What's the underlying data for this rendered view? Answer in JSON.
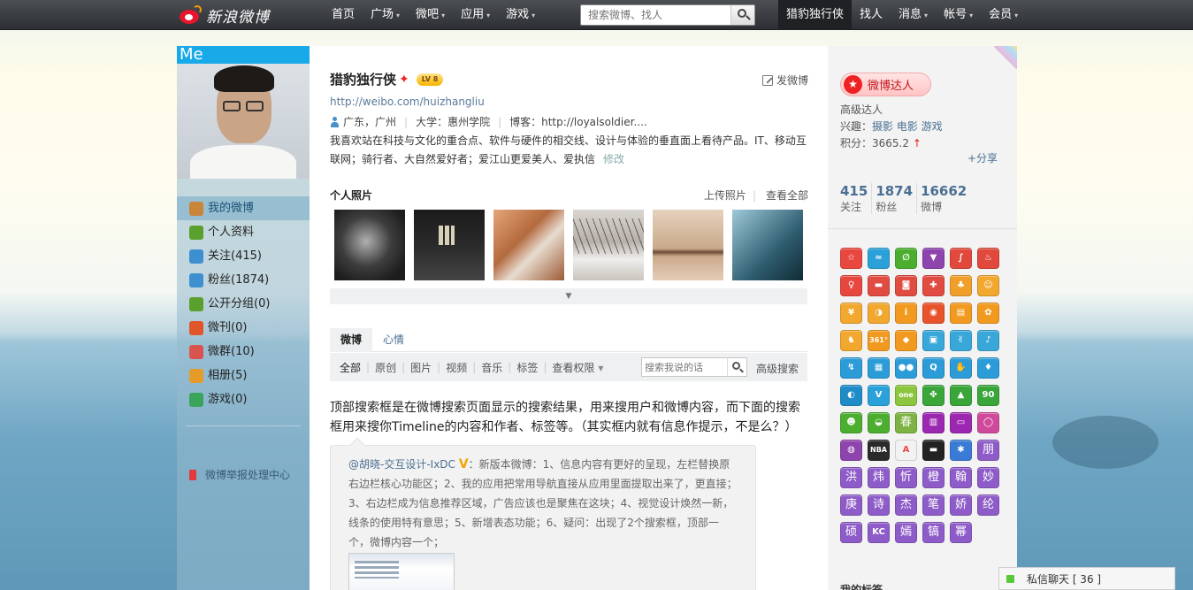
{
  "topbar": {
    "logo_text": "新浪微博",
    "nav": [
      {
        "label": "首页",
        "caret": false
      },
      {
        "label": "广场",
        "caret": true
      },
      {
        "label": "微吧",
        "caret": true
      },
      {
        "label": "应用",
        "caret": true
      },
      {
        "label": "游戏",
        "caret": true
      }
    ],
    "search_placeholder": "搜索微博、找人",
    "right_nav": [
      {
        "label": "猎豹独行侠",
        "caret": false
      },
      {
        "label": "找人",
        "caret": false
      },
      {
        "label": "消息",
        "caret": true
      },
      {
        "label": "帐号",
        "caret": true
      },
      {
        "label": "会员",
        "caret": true
      }
    ],
    "caret_glyph": "▾"
  },
  "left": {
    "avatar_tag": "Me",
    "menu": [
      {
        "label": "我的微博",
        "icon": "home-icon",
        "color": "#c9863a"
      },
      {
        "label": "个人资料",
        "icon": "profile-icon",
        "color": "#5aa02c"
      },
      {
        "label": "关注(415)",
        "icon": "follow-icon",
        "color": "#3d8fd0"
      },
      {
        "label": "粉丝(1874)",
        "icon": "fans-icon",
        "color": "#3d8fd0"
      },
      {
        "label": "公开分组(0)",
        "icon": "group-icon",
        "color": "#5aa02c"
      },
      {
        "label": "微刊(0)",
        "icon": "magazine-icon",
        "color": "#e0552a"
      },
      {
        "label": "微群(10)",
        "icon": "weiqun-icon",
        "color": "#d9534f"
      },
      {
        "label": "相册(5)",
        "icon": "album-icon",
        "color": "#e59b2a"
      },
      {
        "label": "游戏(0)",
        "icon": "game-icon",
        "color": "#3aa55a"
      }
    ],
    "report": "微博举报处理中心"
  },
  "profile": {
    "name": "猎豹独行侠",
    "verified_glyph": "✦",
    "level": "LV 8",
    "post_link": "发微博",
    "url": "http://weibo.com/huizhangliu",
    "location": "广东，广州",
    "school": "大学：惠州学院",
    "blog": "博客：http://loyalsoldier....",
    "bio": "我喜欢站在科技与文化的重合点、软件与硬件的相交线、设计与体验的垂直面上看待产品。IT、移动互联网；骑行者、大自然爱好者；爱江山更爱美人、爱执信",
    "edit": "修改"
  },
  "photos": {
    "title": "个人照片",
    "upload": "上传照片",
    "view_all": "查看全部",
    "more_glyph": "▼"
  },
  "feed": {
    "tabs": [
      "微博",
      "心情"
    ],
    "filters": [
      "全部",
      "原创",
      "图片",
      "视频",
      "音乐",
      "标签",
      "查看权限"
    ],
    "filter_caret": "▾",
    "search_placeholder": "搜索我说的话",
    "advanced": "高级搜索",
    "post_text": "顶部搜索框是在微博搜索页面显示的搜索结果，用来搜用户和微博内容，而下面的搜索框用来搜你Timeline的内容和作者、标签等。（其实框内就有信息作提示，不是么？）",
    "quote_author": "@胡晓-交互设计-IxDC",
    "quote_badge": "V",
    "quote_text": "：新版本微博：1、信息内容有更好的呈现，左栏替换原右边栏核心功能区；2、我的应用把常用导航直接从应用里面提取出来了，更直接；3、右边栏成为信息推荐区域，广告应该也是聚焦在这块；4、视觉设计焕然一新，线条的使用特有意思；5、新增表态功能；6、疑问：出现了2个搜索框，顶部一个，微博内容一个；"
  },
  "right": {
    "badge": "微博达人",
    "level": "高级达人",
    "interests_label": "兴趣：",
    "interests": "摄影 电影 游戏",
    "score_label": "积分：",
    "score": "3665.2",
    "score_up": "↑",
    "share": "+分享",
    "stats": [
      {
        "num": "415",
        "label": "关注"
      },
      {
        "num": "1874",
        "label": "粉丝"
      },
      {
        "num": "16662",
        "label": "微博"
      }
    ],
    "apps": [
      {
        "g": "☆",
        "c": "#e8473f",
        "cn": false,
        "n": "app-star-icon"
      },
      {
        "g": "≈",
        "c": "#2aa1d8",
        "cn": false,
        "n": "app-wave-icon"
      },
      {
        "g": "∅",
        "c": "#4cae2f",
        "cn": false,
        "n": "app-leaf-icon"
      },
      {
        "g": "▼",
        "c": "#8e44ad",
        "cn": false,
        "n": "app-download-icon"
      },
      {
        "g": "∫",
        "c": "#e0493c",
        "cn": false,
        "n": "app-scribble-icon"
      },
      {
        "g": "♨",
        "c": "#e0493c",
        "cn": false,
        "n": "app-fire-icon"
      },
      {
        "g": "♀",
        "c": "#e8473f",
        "cn": false,
        "n": "app-mic-icon"
      },
      {
        "g": "▬",
        "c": "#e14c42",
        "cn": false,
        "n": "app-ship-icon"
      },
      {
        "g": "◙",
        "c": "#e14c42",
        "cn": false,
        "n": "app-camera-icon"
      },
      {
        "g": "✚",
        "c": "#e14c42",
        "cn": false,
        "n": "app-cross-icon"
      },
      {
        "g": "♣",
        "c": "#f0a02a",
        "cn": false,
        "n": "app-bunny-icon"
      },
      {
        "g": "☺",
        "c": "#f2a72e",
        "cn": false,
        "n": "app-face-icon"
      },
      {
        "g": "¥",
        "c": "#f2a72e",
        "cn": false,
        "n": "app-yen-icon"
      },
      {
        "g": "◑",
        "c": "#f2a72e",
        "cn": false,
        "n": "app-moon-icon"
      },
      {
        "g": "i",
        "c": "#f29a1f",
        "cn": false,
        "n": "app-info-icon"
      },
      {
        "g": "◉",
        "c": "#e8532b",
        "cn": false,
        "n": "app-weibo-icon"
      },
      {
        "g": "▤",
        "c": "#f29a1f",
        "cn": false,
        "n": "app-card-icon"
      },
      {
        "g": "✿",
        "c": "#f29a1f",
        "cn": false,
        "n": "app-flower-icon"
      },
      {
        "g": "♞",
        "c": "#f2a72e",
        "cn": false,
        "n": "app-horse-icon"
      },
      {
        "g": "361°",
        "c": "#f29a1f",
        "cn": false,
        "n": "app-361-icon"
      },
      {
        "g": "◆",
        "c": "#f29a1f",
        "cn": false,
        "n": "app-car-icon"
      },
      {
        "g": "▣",
        "c": "#39a8d9",
        "cn": false,
        "n": "app-frame-icon"
      },
      {
        "g": "✌",
        "c": "#39a8d9",
        "cn": false,
        "n": "app-hand-icon"
      },
      {
        "g": "♪",
        "c": "#39a8d9",
        "cn": false,
        "n": "app-guitar-icon"
      },
      {
        "g": "↯",
        "c": "#2b9cd8",
        "cn": false,
        "n": "app-flag-icon"
      },
      {
        "g": "▦",
        "c": "#2b9cd8",
        "cn": false,
        "n": "app-doc-icon"
      },
      {
        "g": "●●",
        "c": "#2b9cd8",
        "cn": false,
        "n": "app-people-icon"
      },
      {
        "g": "Q",
        "c": "#2b9cd8",
        "cn": false,
        "n": "app-q-icon"
      },
      {
        "g": "✋",
        "c": "#2b9cd8",
        "cn": false,
        "n": "app-palm-icon"
      },
      {
        "g": "♦",
        "c": "#2b9cd8",
        "cn": false,
        "n": "app-drop-icon"
      },
      {
        "g": "◐",
        "c": "#1f8cc8",
        "cn": false,
        "n": "app-gauge-icon"
      },
      {
        "g": "V",
        "c": "#2aa1d8",
        "cn": false,
        "n": "app-v-icon"
      },
      {
        "g": "one",
        "c": "#8cc63f",
        "cn": false,
        "n": "app-one-icon"
      },
      {
        "g": "✤",
        "c": "#3aa63a",
        "cn": false,
        "n": "app-branch-icon"
      },
      {
        "g": "▲",
        "c": "#3aa63a",
        "cn": false,
        "n": "app-chart-icon"
      },
      {
        "g": "90",
        "c": "#3aa63a",
        "cn": false,
        "n": "app-90-icon"
      },
      {
        "g": "☻",
        "c": "#4cae2f",
        "cn": false,
        "n": "app-frog-icon"
      },
      {
        "g": "◒",
        "c": "#4cae2f",
        "cn": false,
        "n": "app-bag-icon"
      },
      {
        "g": "春",
        "c": "#7cb342",
        "cn": true,
        "n": "app-spring-icon"
      },
      {
        "g": "▥",
        "c": "#9c27b0",
        "cn": false,
        "n": "app-bars-icon"
      },
      {
        "g": "▭",
        "c": "#9c27b0",
        "cn": false,
        "n": "app-tv-icon"
      },
      {
        "g": "◯",
        "c": "#d04a9c",
        "cn": false,
        "n": "app-bubble-icon"
      },
      {
        "g": "◍",
        "c": "#8e44ad",
        "cn": false,
        "n": "app-lady-icon"
      },
      {
        "g": "NBA",
        "c": "#2a2a2a",
        "cn": false,
        "n": "app-nba-icon"
      },
      {
        "g": "A",
        "c": "#f2f2f2",
        "cn": false,
        "n": "app-a-icon"
      },
      {
        "g": "▬",
        "c": "#222222",
        "cn": false,
        "n": "app-bar-icon"
      },
      {
        "g": "✱",
        "c": "#3a7bd5",
        "cn": false,
        "n": "app-asterisk-icon"
      },
      {
        "g": "朋",
        "c": "#8e5cc8",
        "cn": true,
        "n": "app-peng-icon"
      },
      {
        "g": "洪",
        "c": "#8e5cc8",
        "cn": true,
        "n": "app-hong-icon"
      },
      {
        "g": "炜",
        "c": "#8e5cc8",
        "cn": true,
        "n": "app-wei-icon"
      },
      {
        "g": "忻",
        "c": "#8e5cc8",
        "cn": true,
        "n": "app-xin-icon"
      },
      {
        "g": "橙",
        "c": "#8e5cc8",
        "cn": true,
        "n": "app-cheng-icon"
      },
      {
        "g": "翰",
        "c": "#8e5cc8",
        "cn": true,
        "n": "app-han-icon"
      },
      {
        "g": "妙",
        "c": "#8e5cc8",
        "cn": true,
        "n": "app-miao-icon"
      },
      {
        "g": "庚",
        "c": "#8e5cc8",
        "cn": true,
        "n": "app-geng-icon"
      },
      {
        "g": "诗",
        "c": "#8e5cc8",
        "cn": true,
        "n": "app-shi-icon"
      },
      {
        "g": "杰",
        "c": "#8e5cc8",
        "cn": true,
        "n": "app-jie-icon"
      },
      {
        "g": "笔",
        "c": "#8e5cc8",
        "cn": true,
        "n": "app-bi-icon"
      },
      {
        "g": "娇",
        "c": "#8e5cc8",
        "cn": true,
        "n": "app-jiao-icon"
      },
      {
        "g": "纶",
        "c": "#8e5cc8",
        "cn": true,
        "n": "app-lun-icon"
      },
      {
        "g": "硕",
        "c": "#8e5cc8",
        "cn": true,
        "n": "app-shuo-icon"
      },
      {
        "g": "KC",
        "c": "#8e5cc8",
        "cn": false,
        "n": "app-kc-icon"
      },
      {
        "g": "嫣",
        "c": "#8e5cc8",
        "cn": true,
        "n": "app-yan-icon"
      },
      {
        "g": "镐",
        "c": "#8e5cc8",
        "cn": true,
        "n": "app-gao-icon"
      },
      {
        "g": "幂",
        "c": "#8e5cc8",
        "cn": true,
        "n": "app-mi-icon"
      }
    ],
    "bottom_title": "我的标签"
  },
  "chat": {
    "label": "私信聊天 [ 36 ]"
  }
}
